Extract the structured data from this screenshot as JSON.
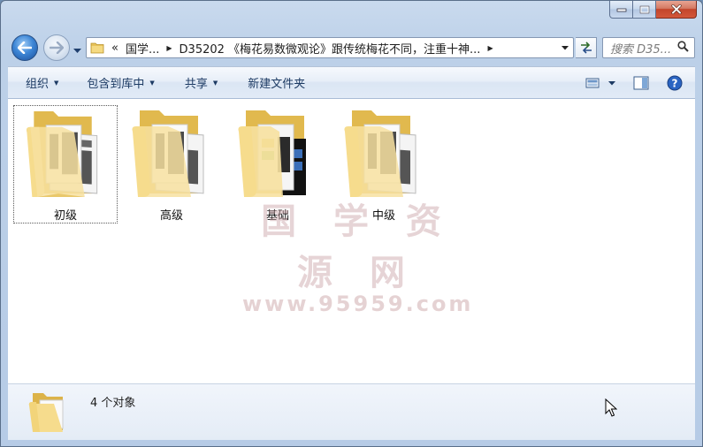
{
  "window": {
    "caption": {
      "minimize_icon": "minimize-icon",
      "maximize_icon": "maximize-icon",
      "close_icon": "close-icon"
    }
  },
  "nav": {
    "back_icon": "arrow-left-icon",
    "forward_icon": "arrow-right-icon",
    "breadcrumb": [
      {
        "label": "«"
      },
      {
        "label": "国学..."
      },
      {
        "label": "D35202 《梅花易数微观论》跟传统梅花不同，注重十神..."
      }
    ],
    "search_placeholder": "搜索 D35..."
  },
  "toolbar": {
    "organize": "组织",
    "include_in_library": "包含到库中",
    "share": "共享",
    "new_folder": "新建文件夹"
  },
  "files": [
    {
      "name": "初级",
      "selected": true
    },
    {
      "name": "高级",
      "selected": false
    },
    {
      "name": "基础",
      "selected": false
    },
    {
      "name": "中级",
      "selected": false
    }
  ],
  "watermark": {
    "title": "国 学 资 源 网",
    "url": "www.95959.com"
  },
  "details": {
    "count_text": "4 个对象"
  },
  "colors": {
    "folder_yellow": "#f2d47a",
    "accent_blue": "#1c3a63",
    "close_red": "#c3452b"
  }
}
